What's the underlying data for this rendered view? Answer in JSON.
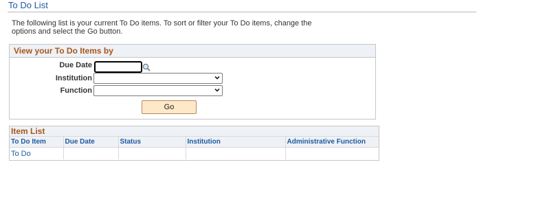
{
  "page": {
    "title": "To Do List",
    "intro": "The following list is your current To Do items. To sort or filter your To Do items, change the options and select the Go button."
  },
  "filter": {
    "header": "View your To Do Items by",
    "due_date_label": "Due Date",
    "due_date_value": "",
    "institution_label": "Institution",
    "institution_selected": "",
    "function_label": "Function",
    "function_selected": "",
    "go_label": "Go"
  },
  "item_list": {
    "header": "Item List",
    "columns": [
      "To Do Item",
      "Due Date",
      "Status",
      "Institution",
      "Administrative Function"
    ],
    "rows": [
      {
        "todo_item": "To Do",
        "due_date": "",
        "status": "",
        "institution": "",
        "admin_function": ""
      }
    ]
  },
  "colors": {
    "title": "#1d5aa3",
    "section_header": "#a5561d",
    "go_button_bg": "#fde8c7"
  },
  "icons": {
    "lookup": "magnifier-icon",
    "dropdown": "chevron-down-icon"
  }
}
